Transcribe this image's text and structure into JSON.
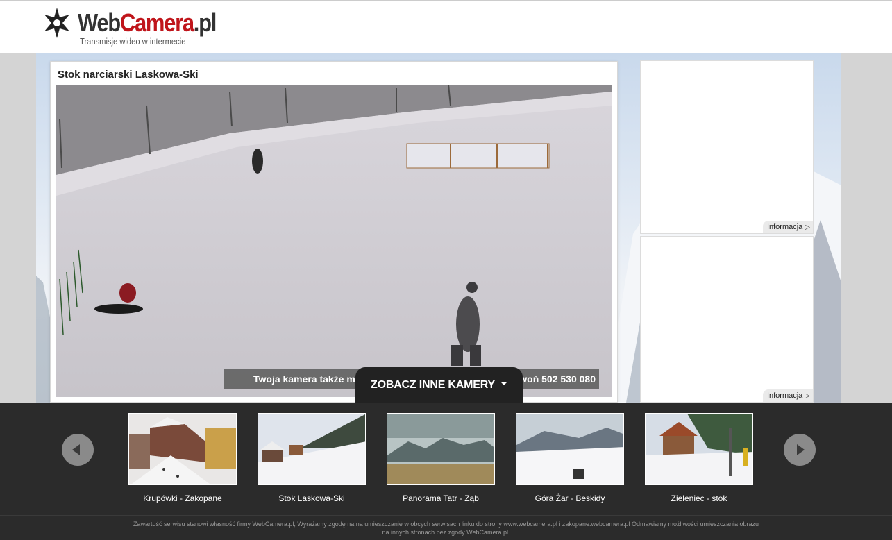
{
  "header": {
    "logo_main": "Web",
    "logo_accent": "Camera",
    "logo_tld": ".pl",
    "tagline": "Transmisje wideo w intermecie"
  },
  "camera": {
    "title": "Stok narciarski Laskowa-Ski",
    "promo_left": "Twoja kamera także m",
    "promo_right": "woń 502 530 080"
  },
  "ads": [
    {
      "info_label": "Informacja"
    },
    {
      "info_label": "Informacja"
    }
  ],
  "other_cameras": {
    "tab_label": "ZOBACZ INNE KAMERY",
    "items": [
      {
        "label": "Krupówki - Zakopane"
      },
      {
        "label": "Stok Laskowa-Ski"
      },
      {
        "label": "Panorama Tatr - Ząb"
      },
      {
        "label": "Góra Żar - Beskidy"
      },
      {
        "label": "Zieleniec - stok"
      }
    ]
  },
  "footer": {
    "line1": "Zawartość serwisu stanowi własność firmy WebCamera.pl, Wyrażamy zgodę na na umieszczanie w obcych serwisach linku do strony www.webcamera.pl i zakopane.webcamera.pl Odmawiamy możliwości umieszczania obrazu",
    "line2": "na innych stronach bez zgody WebCamera.pl."
  },
  "colors": {
    "brand_red": "#c0151b",
    "dark_bar": "#2b2b2b"
  }
}
